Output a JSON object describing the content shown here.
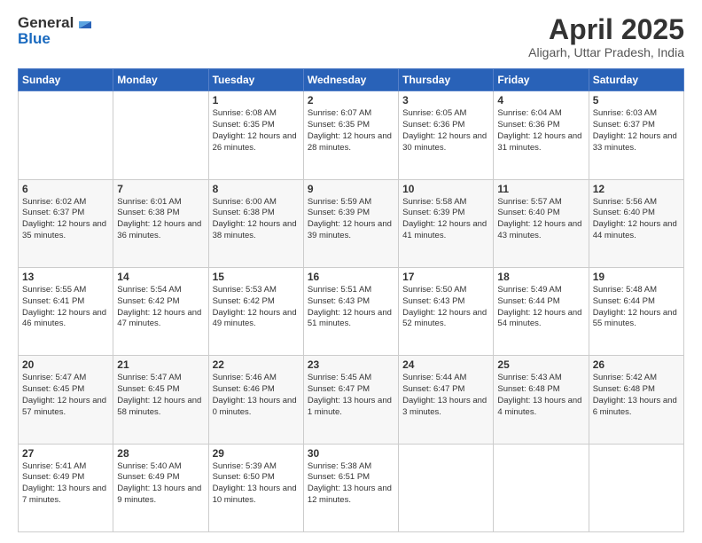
{
  "header": {
    "logo_line1": "General",
    "logo_line2": "Blue",
    "month_title": "April 2025",
    "location": "Aligarh, Uttar Pradesh, India"
  },
  "days_of_week": [
    "Sunday",
    "Monday",
    "Tuesday",
    "Wednesday",
    "Thursday",
    "Friday",
    "Saturday"
  ],
  "weeks": [
    [
      {
        "day": "",
        "info": ""
      },
      {
        "day": "",
        "info": ""
      },
      {
        "day": "1",
        "info": "Sunrise: 6:08 AM\nSunset: 6:35 PM\nDaylight: 12 hours and 26 minutes."
      },
      {
        "day": "2",
        "info": "Sunrise: 6:07 AM\nSunset: 6:35 PM\nDaylight: 12 hours and 28 minutes."
      },
      {
        "day": "3",
        "info": "Sunrise: 6:05 AM\nSunset: 6:36 PM\nDaylight: 12 hours and 30 minutes."
      },
      {
        "day": "4",
        "info": "Sunrise: 6:04 AM\nSunset: 6:36 PM\nDaylight: 12 hours and 31 minutes."
      },
      {
        "day": "5",
        "info": "Sunrise: 6:03 AM\nSunset: 6:37 PM\nDaylight: 12 hours and 33 minutes."
      }
    ],
    [
      {
        "day": "6",
        "info": "Sunrise: 6:02 AM\nSunset: 6:37 PM\nDaylight: 12 hours and 35 minutes."
      },
      {
        "day": "7",
        "info": "Sunrise: 6:01 AM\nSunset: 6:38 PM\nDaylight: 12 hours and 36 minutes."
      },
      {
        "day": "8",
        "info": "Sunrise: 6:00 AM\nSunset: 6:38 PM\nDaylight: 12 hours and 38 minutes."
      },
      {
        "day": "9",
        "info": "Sunrise: 5:59 AM\nSunset: 6:39 PM\nDaylight: 12 hours and 39 minutes."
      },
      {
        "day": "10",
        "info": "Sunrise: 5:58 AM\nSunset: 6:39 PM\nDaylight: 12 hours and 41 minutes."
      },
      {
        "day": "11",
        "info": "Sunrise: 5:57 AM\nSunset: 6:40 PM\nDaylight: 12 hours and 43 minutes."
      },
      {
        "day": "12",
        "info": "Sunrise: 5:56 AM\nSunset: 6:40 PM\nDaylight: 12 hours and 44 minutes."
      }
    ],
    [
      {
        "day": "13",
        "info": "Sunrise: 5:55 AM\nSunset: 6:41 PM\nDaylight: 12 hours and 46 minutes."
      },
      {
        "day": "14",
        "info": "Sunrise: 5:54 AM\nSunset: 6:42 PM\nDaylight: 12 hours and 47 minutes."
      },
      {
        "day": "15",
        "info": "Sunrise: 5:53 AM\nSunset: 6:42 PM\nDaylight: 12 hours and 49 minutes."
      },
      {
        "day": "16",
        "info": "Sunrise: 5:51 AM\nSunset: 6:43 PM\nDaylight: 12 hours and 51 minutes."
      },
      {
        "day": "17",
        "info": "Sunrise: 5:50 AM\nSunset: 6:43 PM\nDaylight: 12 hours and 52 minutes."
      },
      {
        "day": "18",
        "info": "Sunrise: 5:49 AM\nSunset: 6:44 PM\nDaylight: 12 hours and 54 minutes."
      },
      {
        "day": "19",
        "info": "Sunrise: 5:48 AM\nSunset: 6:44 PM\nDaylight: 12 hours and 55 minutes."
      }
    ],
    [
      {
        "day": "20",
        "info": "Sunrise: 5:47 AM\nSunset: 6:45 PM\nDaylight: 12 hours and 57 minutes."
      },
      {
        "day": "21",
        "info": "Sunrise: 5:47 AM\nSunset: 6:45 PM\nDaylight: 12 hours and 58 minutes."
      },
      {
        "day": "22",
        "info": "Sunrise: 5:46 AM\nSunset: 6:46 PM\nDaylight: 13 hours and 0 minutes."
      },
      {
        "day": "23",
        "info": "Sunrise: 5:45 AM\nSunset: 6:47 PM\nDaylight: 13 hours and 1 minute."
      },
      {
        "day": "24",
        "info": "Sunrise: 5:44 AM\nSunset: 6:47 PM\nDaylight: 13 hours and 3 minutes."
      },
      {
        "day": "25",
        "info": "Sunrise: 5:43 AM\nSunset: 6:48 PM\nDaylight: 13 hours and 4 minutes."
      },
      {
        "day": "26",
        "info": "Sunrise: 5:42 AM\nSunset: 6:48 PM\nDaylight: 13 hours and 6 minutes."
      }
    ],
    [
      {
        "day": "27",
        "info": "Sunrise: 5:41 AM\nSunset: 6:49 PM\nDaylight: 13 hours and 7 minutes."
      },
      {
        "day": "28",
        "info": "Sunrise: 5:40 AM\nSunset: 6:49 PM\nDaylight: 13 hours and 9 minutes."
      },
      {
        "day": "29",
        "info": "Sunrise: 5:39 AM\nSunset: 6:50 PM\nDaylight: 13 hours and 10 minutes."
      },
      {
        "day": "30",
        "info": "Sunrise: 5:38 AM\nSunset: 6:51 PM\nDaylight: 13 hours and 12 minutes."
      },
      {
        "day": "",
        "info": ""
      },
      {
        "day": "",
        "info": ""
      },
      {
        "day": "",
        "info": ""
      }
    ]
  ]
}
